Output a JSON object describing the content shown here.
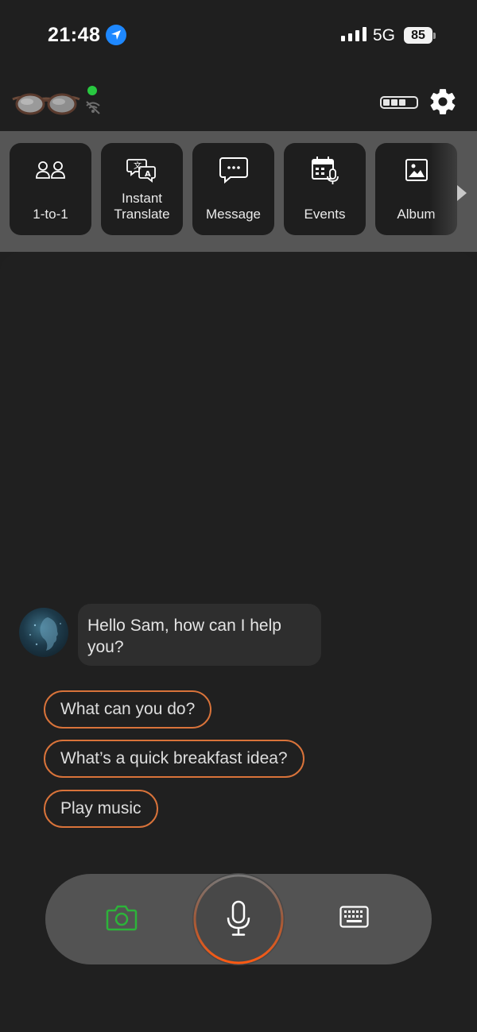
{
  "status": {
    "time": "21:48",
    "network": "5G",
    "battery_level": "85"
  },
  "device": {
    "connection_color": "#28c840",
    "battery_bars": 3
  },
  "features": [
    {
      "label": "1-to-1",
      "icon": "two-people-icon"
    },
    {
      "label": "Instant\nTranslate",
      "icon": "translate-icon"
    },
    {
      "label": "Message",
      "icon": "message-icon"
    },
    {
      "label": "Events",
      "icon": "calendar-mic-icon"
    },
    {
      "label": "Album",
      "icon": "image-icon"
    }
  ],
  "chat": {
    "assistant_message": "Hello Sam, how can I help you?",
    "suggestions": [
      "What can you do?",
      "What’s a quick breakfast idea?",
      "Play music"
    ]
  },
  "controls": {
    "camera_icon": "camera-icon",
    "mic_icon": "microphone-icon",
    "keyboard_icon": "keyboard-icon",
    "accent_color": "#d9733a",
    "camera_color": "#2db33a"
  }
}
